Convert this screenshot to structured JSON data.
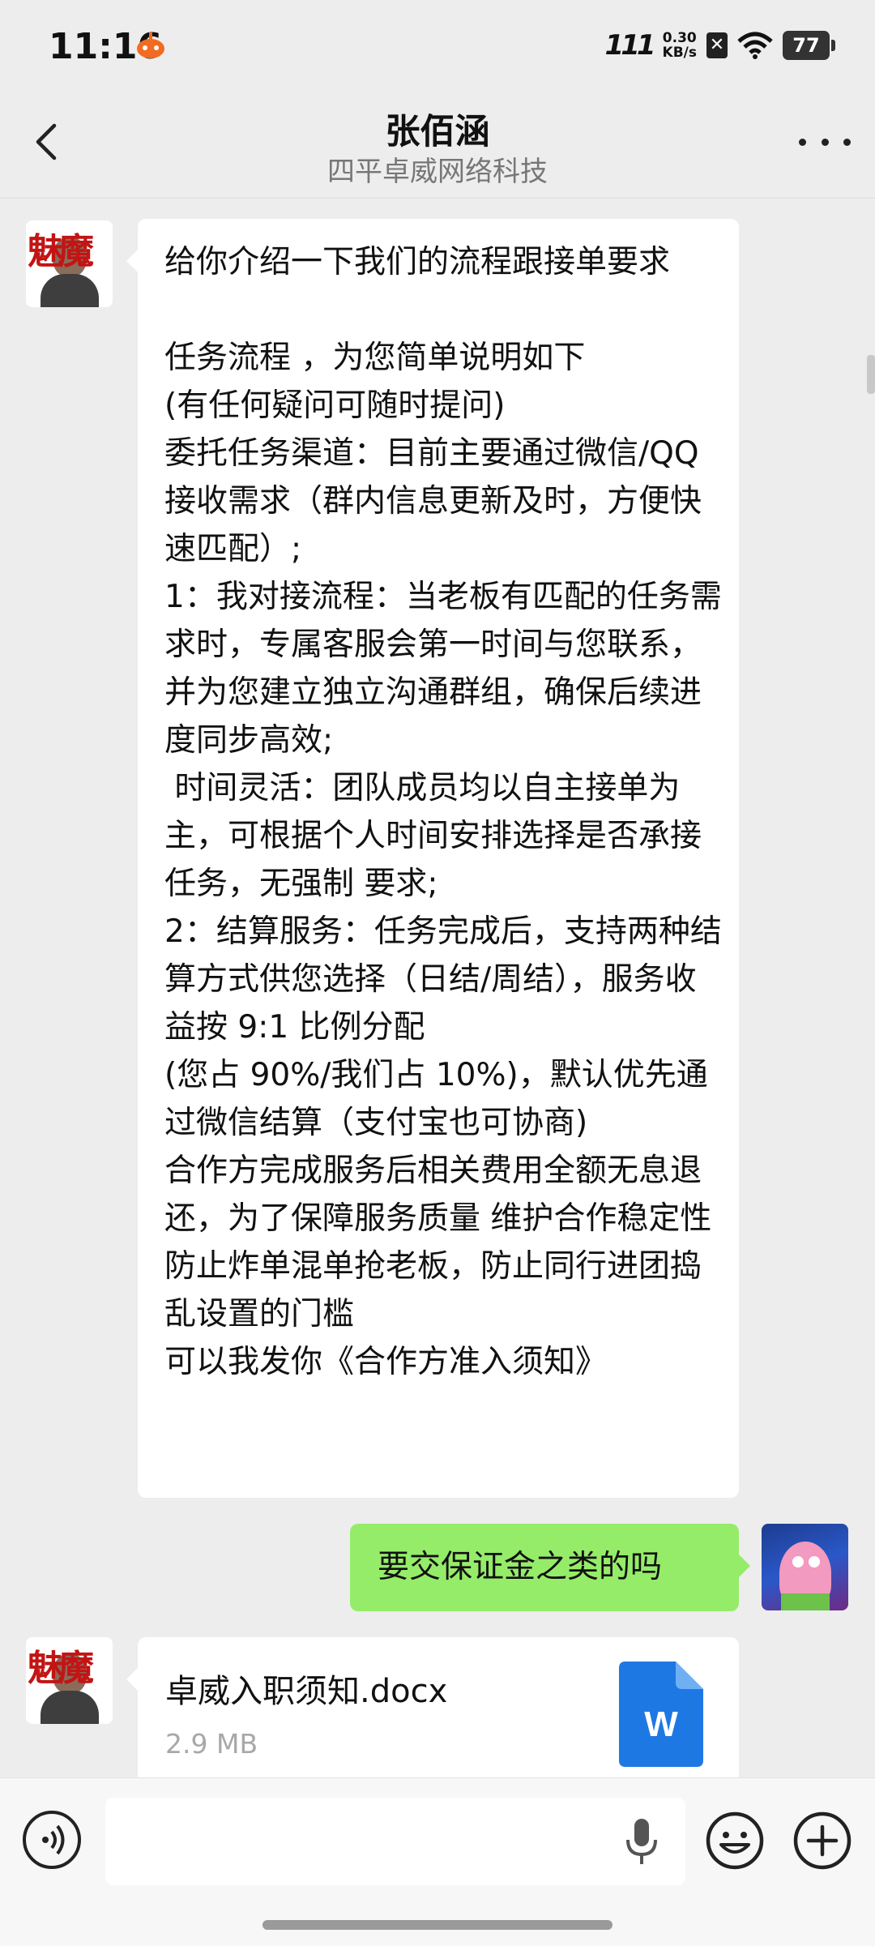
{
  "status_bar": {
    "time": "11:16",
    "signal": "111",
    "net_speed_value": "0.30",
    "net_speed_unit": "KB/s",
    "battery": "77"
  },
  "header": {
    "contact_name": "张佰涵",
    "contact_subtitle": "四平卓威网络科技"
  },
  "messages": [
    {
      "side": "left",
      "type": "text",
      "text": "给你介绍一下我们的流程跟接单要求\n\n任务流程 ，为您简单说明如下\n(有任何疑问可随时提问)\n委托任务渠道：目前主要通过微信/QQ 接收需求（群内信息更新及时，方便快速匹配）;\n1：我对接流程：当老板有匹配的任务需求时，专属客服会第一时间与您联系，并为您建立独立沟通群组，确保后续进度同步高效;\n 时间灵活：团队成员均以自主接单为主，可根据个人时间安排选择是否承接任务，无强制 要求;\n2：结算服务：任务完成后，支持两种结算方式供您选择（日结/周结），服务收益按 9:1 比例分配\n(您占 90%/我们占 10%)，默认优先通过微信结算（支付宝也可协商)\n合作方完成服务后相关费用全额无息退还，为了保障服务质量 维护合作稳定性 防止炸单混单抢老板，防止同行进团捣乱设置的门槛\n可以我发你《合作方准入须知》"
    },
    {
      "side": "right",
      "type": "text",
      "text": "要交保证金之类的吗"
    },
    {
      "side": "left",
      "type": "file",
      "file_name": "卓威入职须知.docx",
      "file_size": "2.9 MB",
      "file_icon_letter": "W"
    }
  ],
  "colors": {
    "background": "#ededed",
    "bubble_self": "#95ec69",
    "bubble_other": "#ffffff",
    "word_blue": "#1e78e4"
  },
  "input_bar": {
    "icons": [
      "voice-icon",
      "microphone-icon",
      "emoji-icon",
      "plus-icon"
    ]
  }
}
